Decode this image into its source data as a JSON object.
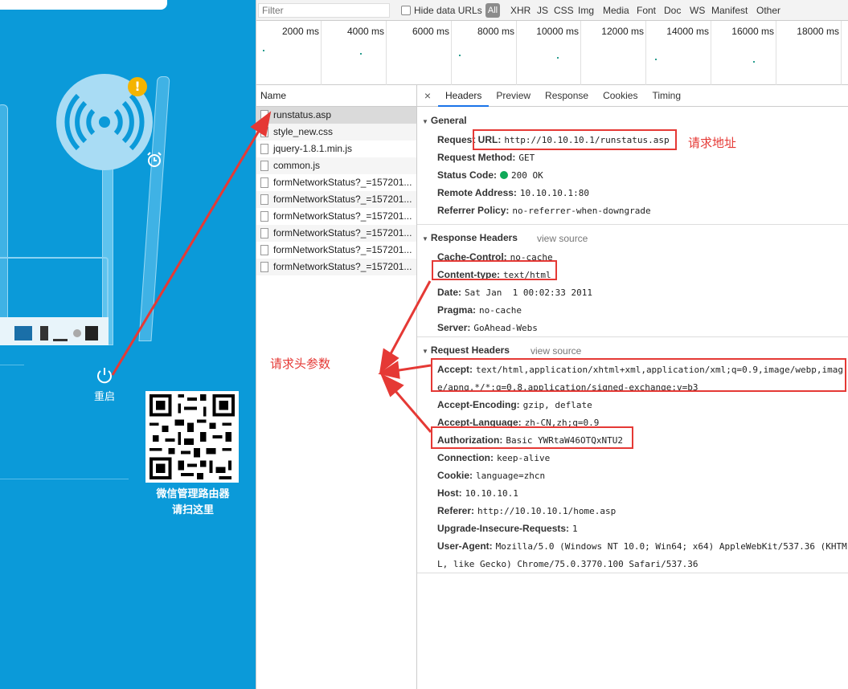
{
  "left_panel": {
    "reboot_label": "重启",
    "qr_caption_line1": "微信管理路由器",
    "qr_caption_line2": "请扫这里",
    "warning_badge": "!"
  },
  "filterbar": {
    "filter_placeholder": "Filter",
    "hide_data_urls": "Hide data URLs",
    "types": [
      "All",
      "XHR",
      "JS",
      "CSS",
      "Img",
      "Media",
      "Font",
      "Doc",
      "WS",
      "Manifest",
      "Other"
    ]
  },
  "timeline": {
    "ticks": [
      "2000 ms",
      "4000 ms",
      "6000 ms",
      "8000 ms",
      "10000 ms",
      "12000 ms",
      "14000 ms",
      "16000 ms",
      "18000 ms"
    ]
  },
  "requests": {
    "header": "Name",
    "items": [
      "runstatus.asp",
      "style_new.css",
      "jquery-1.8.1.min.js",
      "common.js",
      "formNetworkStatus?_=157201...",
      "formNetworkStatus?_=157201...",
      "formNetworkStatus?_=157201...",
      "formNetworkStatus?_=157201...",
      "formNetworkStatus?_=157201...",
      "formNetworkStatus?_=157201..."
    ]
  },
  "tabs": {
    "close": "×",
    "items": [
      "Headers",
      "Preview",
      "Response",
      "Cookies",
      "Timing"
    ]
  },
  "general": {
    "title": "General",
    "request_url_key": "Request URL:",
    "request_url": "http://10.10.10.1/runstatus.asp",
    "request_method_key": "Request Method:",
    "request_method": "GET",
    "status_code_key": "Status Code:",
    "status_code": "200 OK",
    "remote_address_key": "Remote Address:",
    "remote_address": "10.10.10.1:80",
    "referrer_policy_key": "Referrer Policy:",
    "referrer_policy": "no-referrer-when-downgrade"
  },
  "response_headers": {
    "title": "Response Headers",
    "view_source": "view source",
    "cache_control_key": "Cache-Control:",
    "cache_control": "no-cache",
    "content_type_key": "Content-type:",
    "content_type": "text/html",
    "date_key": "Date:",
    "date": "Sat Jan  1 00:02:33 2011",
    "pragma_key": "Pragma:",
    "pragma": "no-cache",
    "server_key": "Server:",
    "server": "GoAhead-Webs"
  },
  "request_headers": {
    "title": "Request Headers",
    "view_source": "view source",
    "accept_key": "Accept:",
    "accept_line1": "text/html,application/xhtml+xml,application/xml;q=0.9,image/webp,imag",
    "accept_line2": "e/apng,*/*;q=0.8,application/signed-exchange;v=b3",
    "accept_encoding_key": "Accept-Encoding:",
    "accept_encoding": "gzip, deflate",
    "accept_language_key": "Accept-Language:",
    "accept_language": "zh-CN,zh;q=0.9",
    "authorization_key": "Authorization:",
    "authorization": "Basic YWRtaW46OTQxNTU2",
    "connection_key": "Connection:",
    "connection": "keep-alive",
    "cookie_key": "Cookie:",
    "cookie": "language=zhcn",
    "host_key": "Host:",
    "host": "10.10.10.1",
    "referer_key": "Referer:",
    "referer": "http://10.10.10.1/home.asp",
    "upgrade_key": "Upgrade-Insecure-Requests:",
    "upgrade": "1",
    "user_agent_key": "User-Agent:",
    "user_agent_line1": "Mozilla/5.0 (Windows NT 10.0; Win64; x64) AppleWebKit/537.36 (KHTM",
    "user_agent_line2": "L, like Gecko) Chrome/75.0.3770.100 Safari/537.36"
  },
  "annotations": {
    "request_url_note": "请求地址",
    "request_headers_note": "请求头参数",
    "color": "#e53935"
  }
}
